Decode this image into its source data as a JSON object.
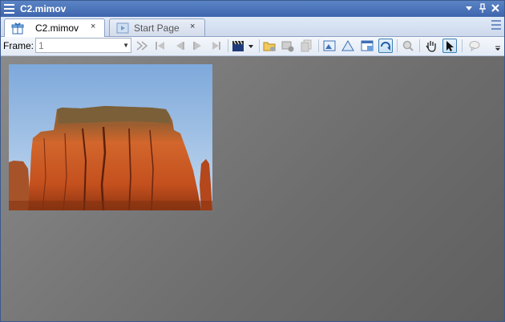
{
  "window": {
    "title": "C2.mimov"
  },
  "tabs": [
    {
      "label": "C2.mimov",
      "close": "×"
    },
    {
      "label": "Start Page",
      "close": "×"
    }
  ],
  "toolbar": {
    "frame_label": "Frame:",
    "frame_value": "1"
  },
  "colors": {
    "titlebar": "#4a73b8",
    "canvas": "#767676",
    "sky": "#9fc4e8",
    "rock": "#c5572a"
  },
  "icons": [
    "menu-icon",
    "dropdown-arrow-icon",
    "pin-icon",
    "close-icon",
    "gift-icon",
    "start-page-icon",
    "tab-list-icon",
    "play-icon",
    "first-frame-icon",
    "previous-frame-icon",
    "next-frame-icon",
    "last-frame-icon",
    "clapperboard-icon",
    "open-folder-icon",
    "settings-icon",
    "copy-icon",
    "image-icon",
    "triangle-icon",
    "window-icon",
    "rotate-icon",
    "zoom-icon",
    "hand-icon",
    "pointer-icon",
    "comment-icon"
  ]
}
